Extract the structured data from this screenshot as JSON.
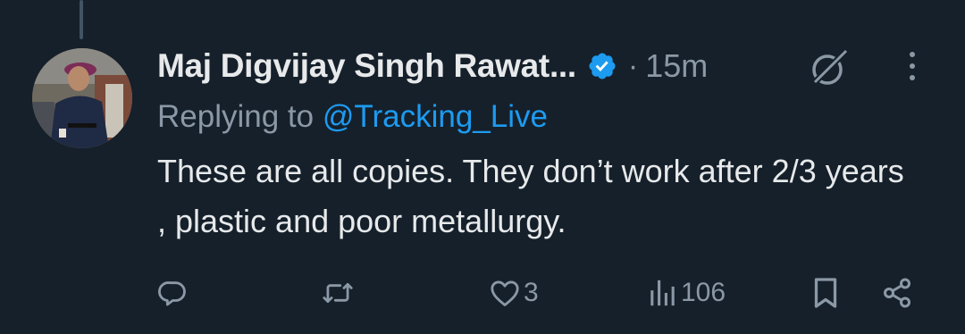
{
  "tweet": {
    "author_name": "Maj Digvijay Singh Rawat...",
    "verified": true,
    "separator": "·",
    "timestamp": "15m",
    "reply_prefix": "Replying to",
    "reply_handle": "@Tracking_Live",
    "text": "These are all copies. They don’t work after 2/3 years , plastic and poor metallurgy."
  },
  "actions": {
    "reply_count": "",
    "retweet_count": "",
    "like_count": "3",
    "views_count": "106"
  },
  "icons": {
    "verified": "verified-badge-icon",
    "grok": "grok-icon",
    "more": "more-options-icon",
    "reply": "reply-icon",
    "retweet": "retweet-icon",
    "like": "heart-icon",
    "views": "views-chart-icon",
    "bookmark": "bookmark-icon",
    "share": "share-icon"
  },
  "colors": {
    "background": "#15202b",
    "text": "#e7e9ea",
    "secondary": "#8b98a5",
    "link": "#1d9bf0"
  }
}
